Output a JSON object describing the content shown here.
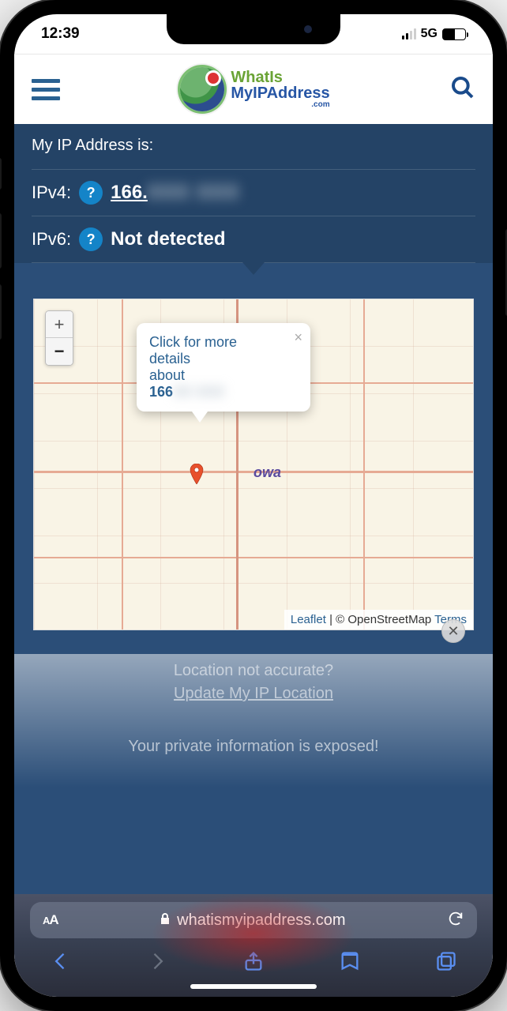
{
  "status_bar": {
    "time": "12:39",
    "network": "5G"
  },
  "logo": {
    "line1": "WhatIs",
    "line2": "MyIPAddress",
    "line3": ".com"
  },
  "ip_section": {
    "heading": "My IP Address is:",
    "ipv4_label": "IPv4:",
    "ipv4_visible": "166.",
    "ipv4_hidden": "XXX XXX",
    "ipv6_label": "IPv6:",
    "ipv6_value": "Not detected",
    "help_symbol": "?"
  },
  "map": {
    "zoom_in": "+",
    "zoom_out": "−",
    "state_label": "owa",
    "popup_line1": "Click for more",
    "popup_line2": "details",
    "popup_line3": "about",
    "popup_ip_visible": "166",
    "popup_ip_hidden": "XX XXX",
    "attrib_leaflet": "Leaflet",
    "attrib_sep": " | © OpenStreetMap ",
    "attrib_terms": "Terms"
  },
  "below_map": {
    "question": "Location not accurate?",
    "update_link": "Update My IP Location",
    "warning": "Your private information is exposed!"
  },
  "browser": {
    "url": "whatismyipaddress.com"
  }
}
